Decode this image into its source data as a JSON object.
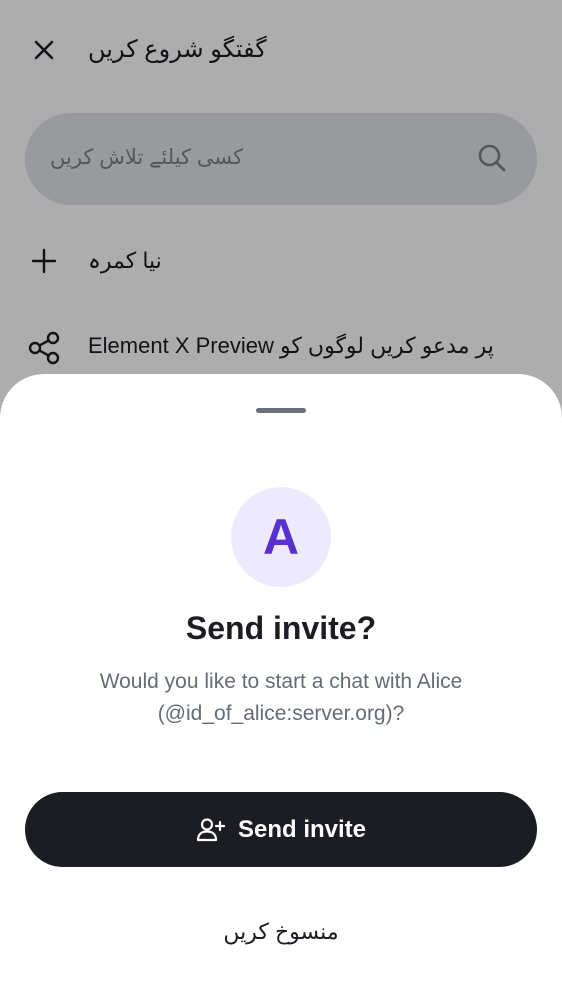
{
  "screen": {
    "title": "گفتگو شروع کریں",
    "search": {
      "placeholder": "کسی کیلئے تلاش کریں"
    },
    "actions": [
      {
        "label": "نیا کمرہ",
        "icon": "plus-icon"
      },
      {
        "label": "Element X Preview پر مدعو کریں لوگوں کو",
        "icon": "share-icon"
      }
    ]
  },
  "sheet": {
    "avatar_letter": "A",
    "title": "Send invite?",
    "body_line1": "Would you like to start a chat with Alice",
    "body_line2": "(@id_of_alice:server.org)?",
    "primary_button": "Send invite",
    "cancel_button": "منسوخ کریں"
  },
  "colors": {
    "accent": "#5a2fcf",
    "avatar_bg": "#eeeafd",
    "primary_bg": "#1b1d22",
    "text_secondary": "#656c76"
  }
}
